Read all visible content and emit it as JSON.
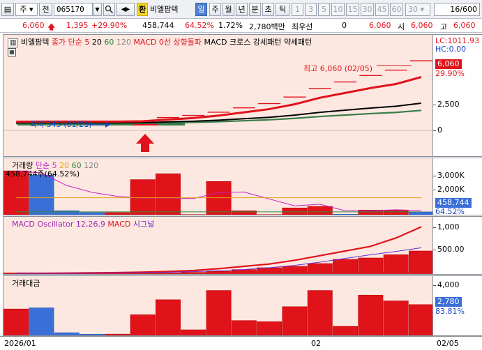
{
  "toolbar": {
    "market": "주",
    "stock_tab": "전",
    "code": "065170",
    "convert_tag": "환",
    "stock_name": "비엘팜텍",
    "periods": [
      "일",
      "주",
      "월",
      "년",
      "분",
      "초",
      "틱"
    ],
    "selected_period": "일",
    "intervals": [
      "1",
      "3",
      "5",
      "10",
      "15",
      "30",
      "45",
      "60"
    ],
    "count_value": "30",
    "page": "16/600"
  },
  "quote": {
    "price": "6,060",
    "change": "1,395",
    "change_pct": "+29.90%",
    "volume": "458,744",
    "volume_ratio": "64.52%",
    "vol_change": "1.72%",
    "amount": "2,780백만",
    "pref_label": "최우선",
    "pref_value": "0",
    "ask": "6,060",
    "open_label": "시",
    "open": "6,060",
    "high_label": "고",
    "high": "6,060"
  },
  "price_pane": {
    "legend_name": "비엘팜텍",
    "legend_ma": "종가 단순",
    "ma_periods": [
      "5",
      "20",
      "60",
      "120"
    ],
    "legend_signal": "MACD 0선 상향돌파",
    "legend_cross": "MACD 크로스 강세패턴",
    "legend_weak": "약세패턴",
    "hi_annotation": "최고 6,060 (02/05)",
    "lo_annotation": "최저 545 (01/21)",
    "lc": "LC:1011.93",
    "hc": "HC:0.00",
    "price_badge": "6,060",
    "price_badge_pct": "29.90%",
    "ticks": [
      "2,500",
      "0"
    ]
  },
  "volume_pane": {
    "legend_name": "거래량",
    "legend_ma": "단순",
    "ma_periods": [
      "5",
      "20",
      "60",
      "120"
    ],
    "readout": "458,744주(64.52%)",
    "badge": "458,744",
    "badge_pct": "64.52%",
    "ticks": [
      "3,000K",
      "2,000K",
      "1,000K"
    ]
  },
  "macd_pane": {
    "legend_name": "MACD Oscillator 12,26,9",
    "legend_macd": "MACD",
    "legend_signal": "시그널",
    "ticks": [
      "1,000",
      "500.00"
    ]
  },
  "amount_pane": {
    "legend_name": "거래대금",
    "badge": "2,780",
    "badge_pct": "83.81%",
    "ticks": [
      "4,000",
      "2,000"
    ]
  },
  "xaxis": {
    "labels": [
      "2026/01",
      "02",
      "02/05"
    ]
  },
  "colors": {
    "up": "#e0131b",
    "down": "#3b6fd8",
    "pane_bg": "#fde8e1"
  },
  "chart_data": {
    "type": "bar",
    "categories": [
      "1",
      "2",
      "3",
      "4",
      "5",
      "6",
      "7",
      "8",
      "9",
      "10",
      "11",
      "12",
      "13",
      "14",
      "15",
      "16",
      "17"
    ],
    "series": [
      {
        "name": "거래량",
        "values": [
          3200,
          2900,
          380,
          250,
          250,
          2580,
          3000,
          110,
          2450,
          380,
          110,
          580,
          690,
          130,
          430,
          420,
          300
        ]
      },
      {
        "name": "거래대금",
        "values": [
          2400,
          2500,
          350,
          220,
          230,
          1900,
          3200,
          600,
          4000,
          1400,
          1300,
          2600,
          4000,
          900,
          3600,
          3100,
          2780
        ]
      },
      {
        "name": "MACD Oscillator",
        "values": [
          0,
          0,
          0,
          0,
          0,
          0,
          5,
          20,
          40,
          80,
          120,
          150,
          210,
          300,
          330,
          400,
          480
        ]
      },
      {
        "name": "MACD",
        "values": [
          0,
          0,
          5,
          10,
          15,
          25,
          40,
          60,
          100,
          150,
          200,
          280,
          380,
          480,
          580,
          760,
          1000
        ]
      },
      {
        "name": "시그널",
        "values": [
          0,
          0,
          0,
          5,
          10,
          15,
          25,
          35,
          55,
          80,
          120,
          170,
          240,
          320,
          400,
          470,
          550
        ]
      },
      {
        "name": "종가",
        "values": [
          545,
          560,
          560,
          550,
          555,
          600,
          800,
          1000,
          1300,
          1700,
          2100,
          2700,
          3500,
          4100,
          4700,
          5200,
          6060
        ]
      }
    ],
    "bar_up": [
      true,
      false,
      false,
      false,
      true,
      true,
      true,
      true,
      true,
      true,
      true,
      true,
      true,
      false,
      true,
      true,
      false
    ]
  }
}
